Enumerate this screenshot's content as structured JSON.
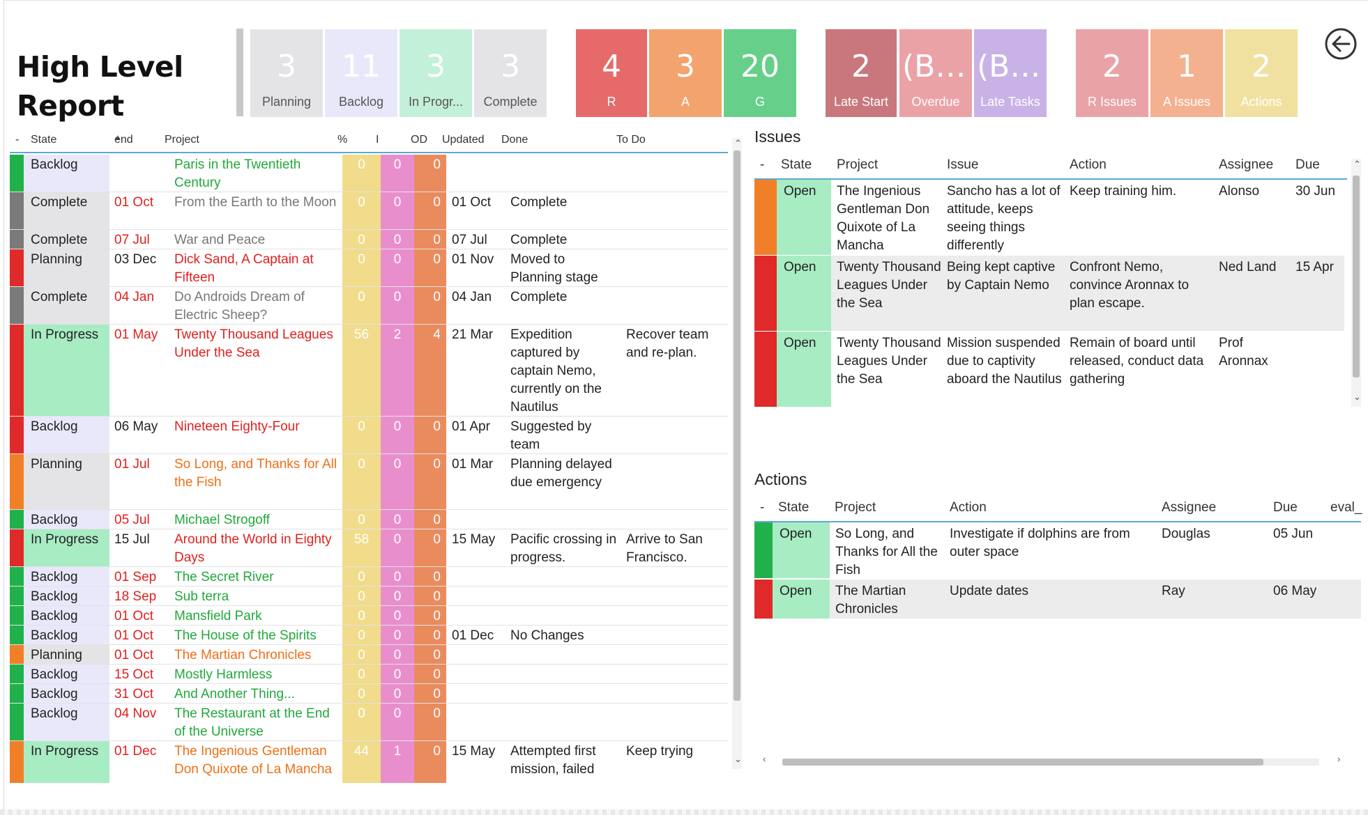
{
  "title_line1": "High Level",
  "title_line2": "Report",
  "tiles": [
    {
      "num": "3",
      "label": "Planning",
      "bg": "#e4e4e6",
      "fg": "#fff",
      "lfg": "#555"
    },
    {
      "num": "11",
      "label": "Backlog",
      "bg": "#e9e8fb",
      "fg": "#fff",
      "lfg": "#555"
    },
    {
      "num": "3",
      "label": "In Progr...",
      "bg": "#c3f0d8",
      "fg": "#fff",
      "lfg": "#555"
    },
    {
      "num": "3",
      "label": "Complete",
      "bg": "#e4e4e6",
      "fg": "#fff",
      "lfg": "#555"
    },
    {
      "num": "4",
      "label": "R",
      "bg": "#e66a6a",
      "fg": "#fff",
      "lfg": "#fff"
    },
    {
      "num": "3",
      "label": "A",
      "bg": "#f3a36e",
      "fg": "#fff",
      "lfg": "#fff"
    },
    {
      "num": "20",
      "label": "G",
      "bg": "#66d08a",
      "fg": "#fff",
      "lfg": "#fff"
    },
    {
      "num": "2",
      "label": "Late Start",
      "bg": "#c9777c",
      "fg": "#fff",
      "lfg": "#fff"
    },
    {
      "num": "(Bl...",
      "label": "Overdue",
      "bg": "#eba2a7",
      "fg": "#fff",
      "lfg": "#fff"
    },
    {
      "num": "(Bl...",
      "label": "Late Tasks",
      "bg": "#c9b2e6",
      "fg": "#fff",
      "lfg": "#fff"
    },
    {
      "num": "2",
      "label": "R Issues",
      "bg": "#e9a3a6",
      "fg": "#fff",
      "lfg": "#fff"
    },
    {
      "num": "1",
      "label": "A Issues",
      "bg": "#f4b190",
      "fg": "#fff",
      "lfg": "#fff"
    },
    {
      "num": "2",
      "label": "Actions",
      "bg": "#f1e1a0",
      "fg": "#fff",
      "lfg": "#fff"
    }
  ],
  "colors": {
    "green": "#21b14b",
    "red": "#e02a2a",
    "orange": "#f07f28",
    "gray": "#7a7a7a",
    "state_backlog": "#e9e8fb",
    "state_complete": "#e4e4e6",
    "state_planning": "#e4e4e6",
    "state_progress": "#a8ecc4",
    "text_green": "#21a83c",
    "text_red": "#e0201e",
    "text_orange": "#ef6f16",
    "text_gray": "#777777"
  },
  "main_table": {
    "headers": {
      "minus": "-",
      "state": "State",
      "end": "end",
      "project": "Project",
      "pct": "%",
      "i": "I",
      "od": "OD",
      "updated": "Updated",
      "done": "Done",
      "todo": "To Do"
    },
    "rows": [
      {
        "rag": "green",
        "state": "Backlog",
        "end": "",
        "end_color": "#222",
        "project": "Paris in the Twentieth Century",
        "proj_color": "green",
        "pct": "0",
        "i": "0",
        "od": "0",
        "updated": "",
        "done": "",
        "todo": "",
        "h": 54
      },
      {
        "rag": "gray",
        "state": "Complete",
        "end": "01 Oct",
        "end_color": "#e0201e",
        "project": "From the Earth to the Moon",
        "proj_color": "gray",
        "pct": "0",
        "i": "0",
        "od": "0",
        "updated": "01 Oct",
        "done": "Complete",
        "todo": "",
        "h": 54
      },
      {
        "rag": "gray",
        "state": "Complete",
        "end": "07 Jul",
        "end_color": "#e0201e",
        "project": "War and Peace",
        "proj_color": "gray",
        "pct": "0",
        "i": "0",
        "od": "0",
        "updated": "07 Jul",
        "done": "Complete",
        "todo": "",
        "h": 28
      },
      {
        "rag": "red",
        "state": "Planning",
        "end": "03 Dec",
        "end_color": "#222",
        "project": "Dick Sand, A Captain at Fifteen",
        "proj_color": "red",
        "pct": "0",
        "i": "0",
        "od": "0",
        "updated": "01 Nov",
        "done": "Moved to Planning stage",
        "todo": "",
        "h": 54
      },
      {
        "rag": "gray",
        "state": "Complete",
        "end": "04 Jan",
        "end_color": "#e0201e",
        "project": "Do Androids Dream of Electric Sheep?",
        "proj_color": "gray",
        "pct": "0",
        "i": "0",
        "od": "0",
        "updated": "04 Jan",
        "done": "Complete",
        "todo": "",
        "h": 54
      },
      {
        "rag": "red",
        "state": "In Progress",
        "end": "01 May",
        "end_color": "#e0201e",
        "project": "Twenty Thousand Leagues Under the Sea",
        "proj_color": "red",
        "pct": "56",
        "i": "2",
        "od": "4",
        "updated": "21 Mar",
        "done": "Expedition captured by captain Nemo, currently on the Nautilus",
        "todo": "Recover team and re-plan.",
        "h": 132
      },
      {
        "rag": "red",
        "state": "Backlog",
        "end": "06 May",
        "end_color": "#222",
        "project": "Nineteen Eighty-Four",
        "proj_color": "red",
        "pct": "0",
        "i": "0",
        "od": "0",
        "updated": "01 Apr",
        "done": "Suggested by team",
        "todo": "",
        "h": 54
      },
      {
        "rag": "orange",
        "state": "Planning",
        "end": "01 Jul",
        "end_color": "#e0201e",
        "project": "So Long, and Thanks for All the Fish",
        "proj_color": "orange",
        "pct": "0",
        "i": "0",
        "od": "0",
        "updated": "01 Mar",
        "done": "Planning delayed due emergency",
        "todo": "",
        "h": 80
      },
      {
        "rag": "green",
        "state": "Backlog",
        "end": "05 Jul",
        "end_color": "#e0201e",
        "project": "Michael Strogoff",
        "proj_color": "green",
        "pct": "0",
        "i": "0",
        "od": "0",
        "updated": "",
        "done": "",
        "todo": "",
        "h": 28
      },
      {
        "rag": "red",
        "state": "In Progress",
        "end": "15 Jul",
        "end_color": "#222",
        "project": "Around the World in Eighty Days",
        "proj_color": "red",
        "pct": "58",
        "i": "0",
        "od": "0",
        "updated": "15 May",
        "done": "Pacific crossing in progress.",
        "todo": "Arrive to San Francisco.",
        "h": 54
      },
      {
        "rag": "green",
        "state": "Backlog",
        "end": "01 Sep",
        "end_color": "#e0201e",
        "project": "The Secret River",
        "proj_color": "green",
        "pct": "0",
        "i": "0",
        "od": "0",
        "updated": "",
        "done": "",
        "todo": "",
        "h": 28
      },
      {
        "rag": "green",
        "state": "Backlog",
        "end": "18 Sep",
        "end_color": "#e0201e",
        "project": "Sub terra",
        "proj_color": "green",
        "pct": "0",
        "i": "0",
        "od": "0",
        "updated": "",
        "done": "",
        "todo": "",
        "h": 28
      },
      {
        "rag": "green",
        "state": "Backlog",
        "end": "01 Oct",
        "end_color": "#e0201e",
        "project": "Mansfield Park",
        "proj_color": "green",
        "pct": "0",
        "i": "0",
        "od": "0",
        "updated": "",
        "done": "",
        "todo": "",
        "h": 28
      },
      {
        "rag": "green",
        "state": "Backlog",
        "end": "01 Oct",
        "end_color": "#e0201e",
        "project": "The House of the Spirits",
        "proj_color": "green",
        "pct": "0",
        "i": "0",
        "od": "0",
        "updated": "01 Dec",
        "done": "No Changes",
        "todo": "",
        "h": 28
      },
      {
        "rag": "orange",
        "state": "Planning",
        "end": "01 Oct",
        "end_color": "#e0201e",
        "project": "The Martian Chronicles",
        "proj_color": "orange",
        "pct": "0",
        "i": "0",
        "od": "0",
        "updated": "",
        "done": "",
        "todo": "",
        "h": 28
      },
      {
        "rag": "green",
        "state": "Backlog",
        "end": "15 Oct",
        "end_color": "#e0201e",
        "project": "Mostly Harmless",
        "proj_color": "green",
        "pct": "0",
        "i": "0",
        "od": "0",
        "updated": "",
        "done": "",
        "todo": "",
        "h": 28
      },
      {
        "rag": "green",
        "state": "Backlog",
        "end": "31 Oct",
        "end_color": "#e0201e",
        "project": "And Another Thing...",
        "proj_color": "green",
        "pct": "0",
        "i": "0",
        "od": "0",
        "updated": "",
        "done": "",
        "todo": "",
        "h": 28
      },
      {
        "rag": "green",
        "state": "Backlog",
        "end": "04 Nov",
        "end_color": "#e0201e",
        "project": "The Restaurant at the End of the Universe",
        "proj_color": "green",
        "pct": "0",
        "i": "0",
        "od": "0",
        "updated": "",
        "done": "",
        "todo": "",
        "h": 54
      },
      {
        "rag": "orange",
        "state": "In Progress",
        "end": "01 Dec",
        "end_color": "#e0201e",
        "project": "The Ingenious Gentleman Don Quixote of La Mancha",
        "proj_color": "orange",
        "pct": "44",
        "i": "1",
        "od": "0",
        "updated": "15 May",
        "done": "Attempted first mission, failed",
        "todo": "Keep trying",
        "h": 80
      }
    ]
  },
  "issues": {
    "title": "Issues",
    "headers": {
      "minus": "-",
      "state": "State",
      "project": "Project",
      "issue": "Issue",
      "action": "Action",
      "assignee": "Assignee",
      "due": "Due"
    },
    "rows": [
      {
        "rag": "orange",
        "state": "Open",
        "project": "The Ingenious Gentleman Don Quixote of La Mancha",
        "issue": "Sancho has a lot of attitude, keeps seeing things differently",
        "action": "Keep training him.",
        "assignee": "Alonso",
        "due": "30 Jun",
        "bg": "#ffffff"
      },
      {
        "rag": "red",
        "state": "Open",
        "project": "Twenty Thousand Leagues Under the Sea",
        "issue": "Being kept captive by Captain Nemo",
        "action": "Confront Nemo, convince Aronnax to plan escape.",
        "assignee": "Ned Land",
        "due": "15 Apr",
        "bg": "#ececec"
      },
      {
        "rag": "red",
        "state": "Open",
        "project": "Twenty Thousand Leagues Under the Sea",
        "issue": "Mission suspended due to captivity aboard the Nautilus",
        "action": "Remain of board until released, conduct data gathering",
        "assignee": "Prof Aronnax",
        "due": "",
        "bg": "#ffffff"
      }
    ]
  },
  "actions": {
    "title": "Actions",
    "headers": {
      "minus": "-",
      "state": "State",
      "project": "Project",
      "action": "Action",
      "assignee": "Assignee",
      "due": "Due",
      "eval": "eval_"
    },
    "rows": [
      {
        "rag": "green",
        "state": "Open",
        "project": "So Long, and Thanks for All the Fish",
        "action": "Investigate if dolphins are from outer space",
        "assignee": "Douglas",
        "due": "05 Jun",
        "bg": "#ffffff"
      },
      {
        "rag": "red",
        "state": "Open",
        "project": "The Martian Chronicles",
        "action": "Update dates",
        "assignee": "Ray",
        "due": "06 May",
        "bg": "#ececec"
      }
    ]
  }
}
